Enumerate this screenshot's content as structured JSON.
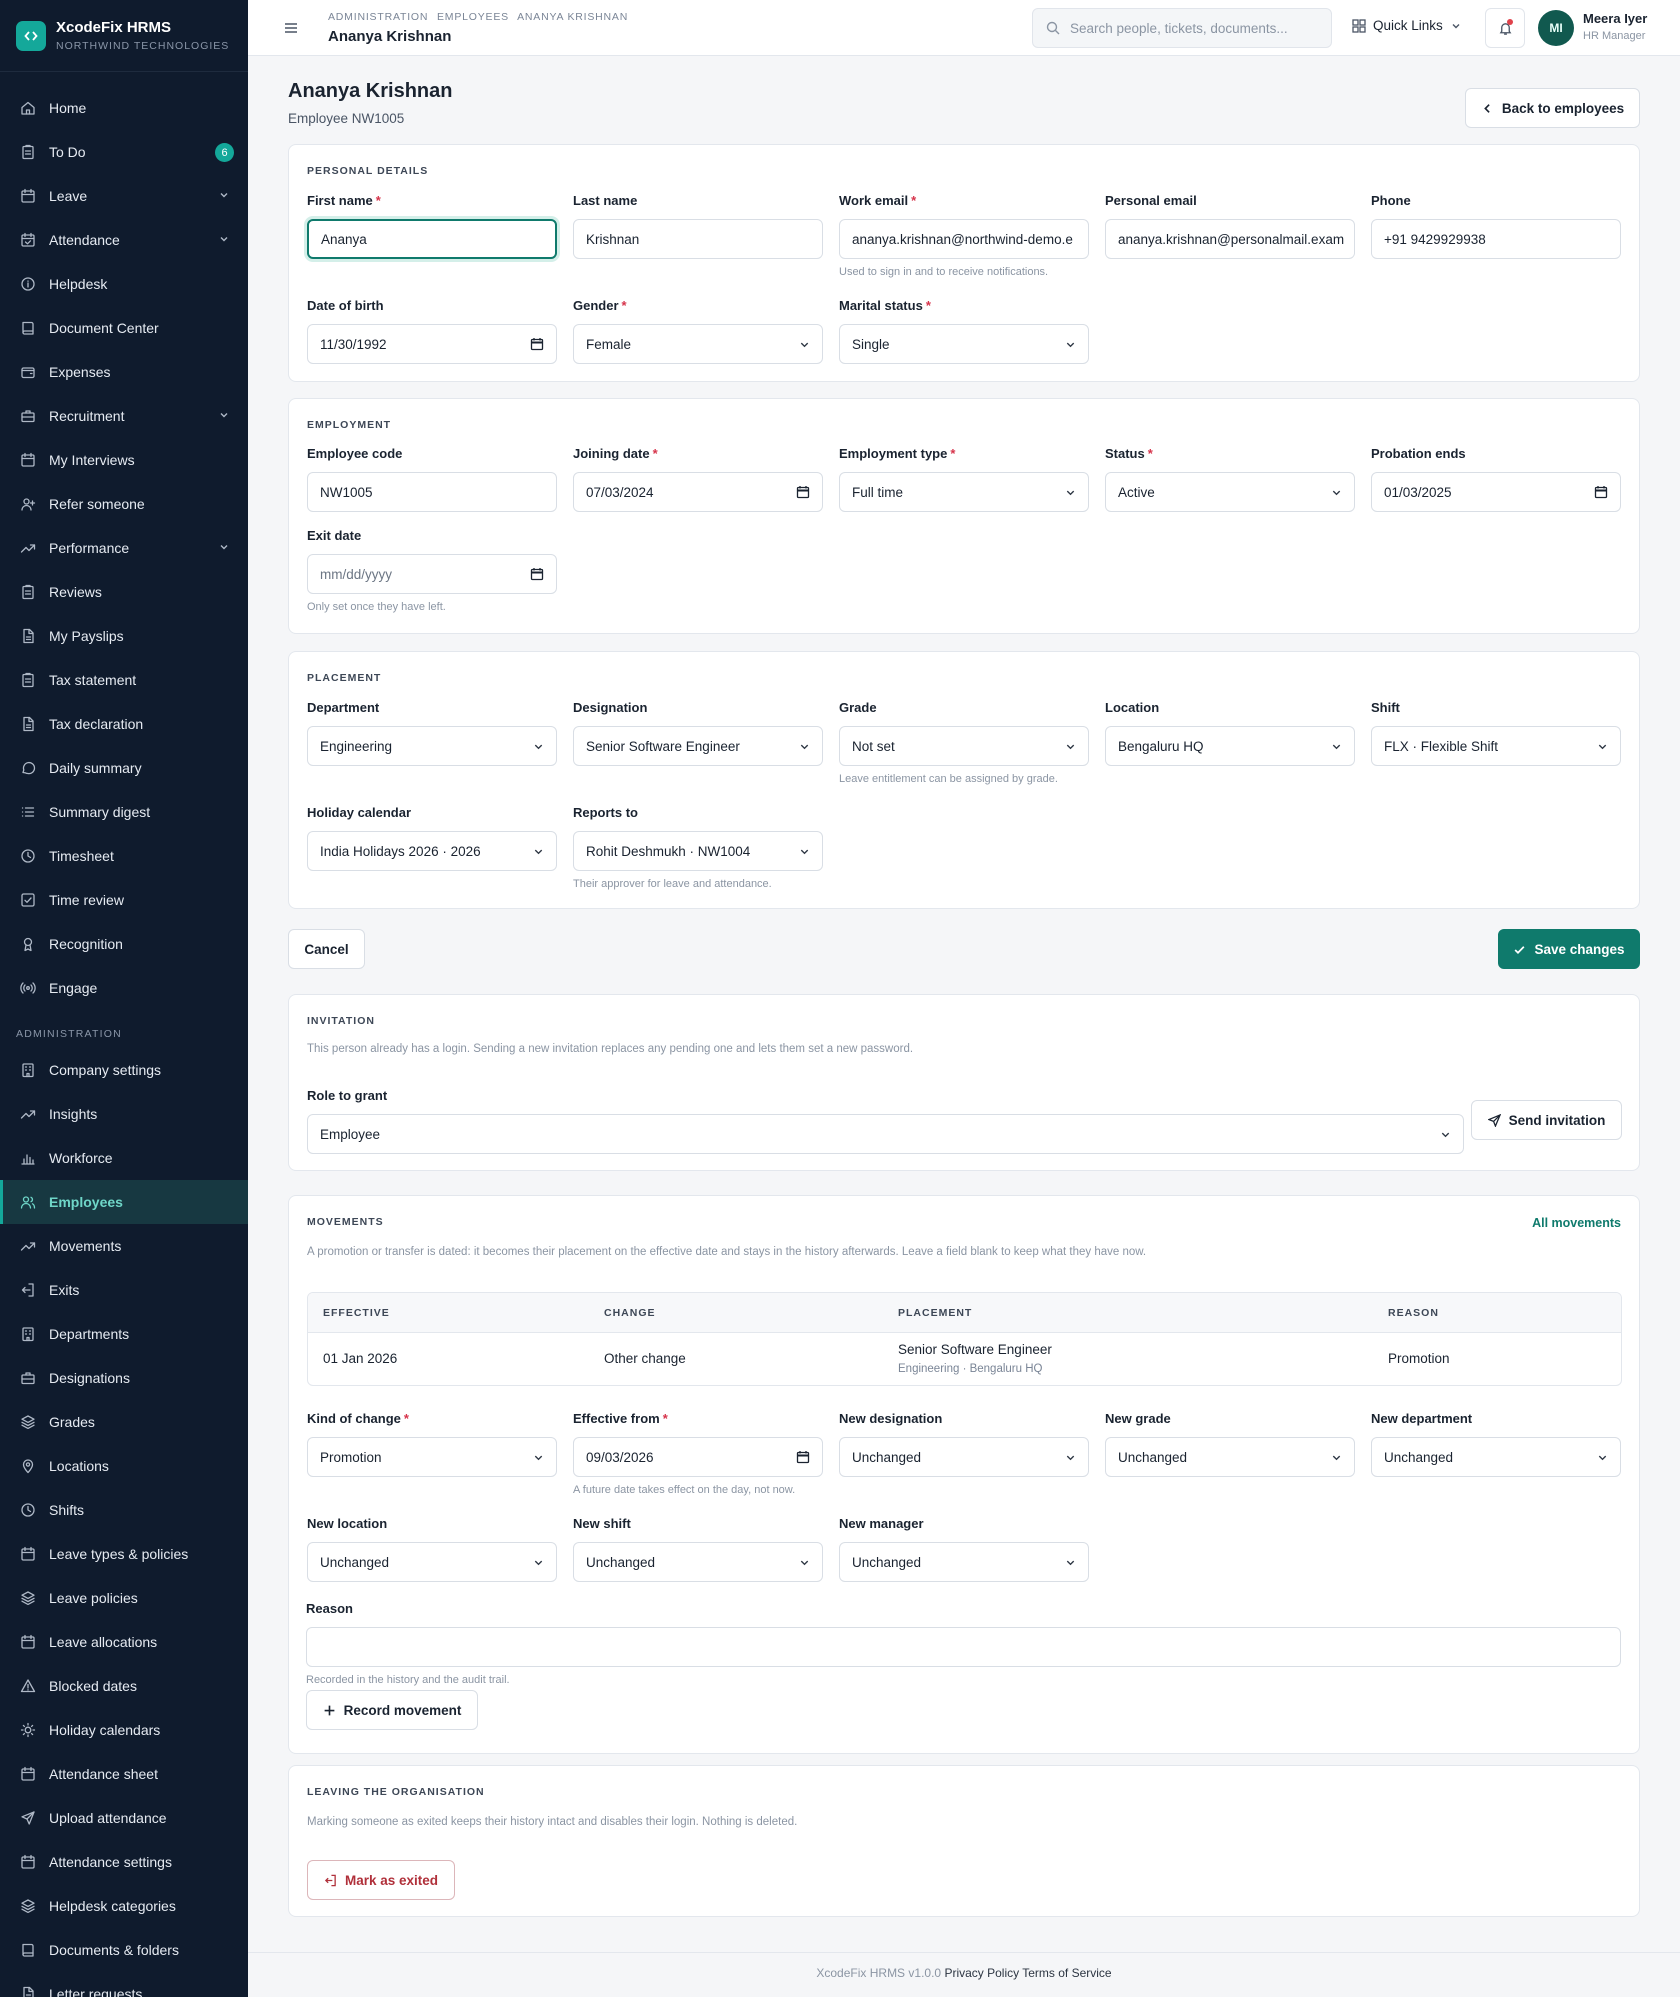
{
  "brand": {
    "name": "XcodeFix HRMS",
    "org": "NORTHWIND TECHNOLOGIES"
  },
  "nav": [
    {
      "label": "Home",
      "icon": "home-icon"
    },
    {
      "label": "To Do",
      "icon": "clipboard-icon",
      "badge": "6"
    },
    {
      "label": "Leave",
      "icon": "calendar-icon",
      "chevron": true
    },
    {
      "label": "Attendance",
      "icon": "calendar-check-icon",
      "chevron": true
    },
    {
      "label": "Helpdesk",
      "icon": "info-icon"
    },
    {
      "label": "Document Center",
      "icon": "book-icon"
    },
    {
      "label": "Expenses",
      "icon": "wallet-icon"
    },
    {
      "label": "Recruitment",
      "icon": "briefcase-icon",
      "chevron": true
    },
    {
      "label": "My Interviews",
      "icon": "calendar-icon"
    },
    {
      "label": "Refer someone",
      "icon": "user-plus-icon"
    },
    {
      "label": "Performance",
      "icon": "trending-up-icon",
      "chevron": true
    },
    {
      "label": "Reviews",
      "icon": "clipboard-icon"
    },
    {
      "label": "My Payslips",
      "icon": "file-icon"
    },
    {
      "label": "Tax statement",
      "icon": "clipboard-icon"
    },
    {
      "label": "Tax declaration",
      "icon": "file-icon"
    },
    {
      "label": "Daily summary",
      "icon": "message-icon"
    },
    {
      "label": "Summary digest",
      "icon": "list-icon"
    },
    {
      "label": "Timesheet",
      "icon": "clock-icon"
    },
    {
      "label": "Time review",
      "icon": "check-square-icon"
    },
    {
      "label": "Recognition",
      "icon": "award-icon"
    },
    {
      "label": "Engage",
      "icon": "broadcast-icon"
    }
  ],
  "admin_section": "ADMINISTRATION",
  "admin_nav": [
    {
      "label": "Company settings",
      "icon": "building-icon"
    },
    {
      "label": "Insights",
      "icon": "trending-up-icon"
    },
    {
      "label": "Workforce",
      "icon": "bar-chart-icon"
    },
    {
      "label": "Employees",
      "icon": "users-icon",
      "active": true
    },
    {
      "label": "Movements",
      "icon": "trending-up-icon"
    },
    {
      "label": "Exits",
      "icon": "log-out-icon"
    },
    {
      "label": "Departments",
      "icon": "building-icon"
    },
    {
      "label": "Designations",
      "icon": "briefcase-icon"
    },
    {
      "label": "Grades",
      "icon": "layers-icon"
    },
    {
      "label": "Locations",
      "icon": "map-pin-icon"
    },
    {
      "label": "Shifts",
      "icon": "clock-icon"
    },
    {
      "label": "Leave types & policies",
      "icon": "calendar-icon"
    },
    {
      "label": "Leave policies",
      "icon": "layers-icon"
    },
    {
      "label": "Leave allocations",
      "icon": "calendar-icon"
    },
    {
      "label": "Blocked dates",
      "icon": "alert-triangle-icon"
    },
    {
      "label": "Holiday calendars",
      "icon": "sun-icon"
    },
    {
      "label": "Attendance sheet",
      "icon": "calendar-icon"
    },
    {
      "label": "Upload attendance",
      "icon": "send-icon"
    },
    {
      "label": "Attendance settings",
      "icon": "calendar-icon"
    },
    {
      "label": "Helpdesk categories",
      "icon": "layers-icon"
    },
    {
      "label": "Documents & folders",
      "icon": "book-icon"
    },
    {
      "label": "Letter requests",
      "icon": "file-icon"
    }
  ],
  "topbar": {
    "breadcrumb": [
      "ADMINISTRATION",
      "EMPLOYEES",
      "ANANYA KRISHNAN"
    ],
    "title": "Ananya Krishnan",
    "search_placeholder": "Search people, tickets, documents...",
    "quick_links": "Quick Links",
    "user": {
      "initials": "MI",
      "name": "Meera Iyer",
      "role": "HR Manager"
    }
  },
  "page": {
    "title": "Ananya Krishnan",
    "subtitle": "Employee NW1005",
    "back": "Back to employees"
  },
  "personal": {
    "title": "PERSONAL DETAILS",
    "first_name": {
      "label": "First name",
      "value": "Ananya"
    },
    "last_name": {
      "label": "Last name",
      "value": "Krishnan"
    },
    "work_email": {
      "label": "Work email",
      "value": "ananya.krishnan@northwind-demo.e",
      "help": "Used to sign in and to receive notifications."
    },
    "personal_email": {
      "label": "Personal email",
      "value": "ananya.krishnan@personalmail.exam"
    },
    "phone": {
      "label": "Phone",
      "value": "+91 9429929938"
    },
    "dob": {
      "label": "Date of birth",
      "value": "11/30/1992"
    },
    "gender": {
      "label": "Gender",
      "value": "Female"
    },
    "marital": {
      "label": "Marital status",
      "value": "Single"
    }
  },
  "employment": {
    "title": "EMPLOYMENT",
    "code": {
      "label": "Employee code",
      "value": "NW1005"
    },
    "joining": {
      "label": "Joining date",
      "value": "07/03/2024"
    },
    "type": {
      "label": "Employment type",
      "value": "Full time"
    },
    "status": {
      "label": "Status",
      "value": "Active"
    },
    "probation": {
      "label": "Probation ends",
      "value": "01/03/2025"
    },
    "exit": {
      "label": "Exit date",
      "value": "mm/dd/yyyy",
      "help": "Only set once they have left."
    }
  },
  "placement": {
    "title": "PLACEMENT",
    "department": {
      "label": "Department",
      "value": "Engineering"
    },
    "designation": {
      "label": "Designation",
      "value": "Senior Software Engineer"
    },
    "grade": {
      "label": "Grade",
      "value": "Not set",
      "help": "Leave entitlement can be assigned by grade."
    },
    "location": {
      "label": "Location",
      "value": "Bengaluru HQ"
    },
    "shift": {
      "label": "Shift",
      "value": "FLX · Flexible Shift"
    },
    "holiday": {
      "label": "Holiday calendar",
      "value": "India Holidays 2026 · 2026"
    },
    "reports": {
      "label": "Reports to",
      "value": "Rohit Deshmukh · NW1004",
      "help": "Their approver for leave and attendance."
    }
  },
  "actions": {
    "cancel": "Cancel",
    "save": "Save changes"
  },
  "invitation": {
    "title": "INVITATION",
    "note": "This person already has a login. Sending a new invitation replaces any pending one and lets them set a new password.",
    "role_label": "Role to grant",
    "role_value": "Employee",
    "send": "Send invitation"
  },
  "movements": {
    "title": "MOVEMENTS",
    "all": "All movements",
    "note": "A promotion or transfer is dated: it becomes their placement on the effective date and stays in the history afterwards. Leave a field blank to keep what they have now.",
    "columns": [
      "EFFECTIVE",
      "CHANGE",
      "PLACEMENT",
      "REASON"
    ],
    "row": {
      "effective": "01 Jan 2026",
      "change": "Other change",
      "placement": "Senior Software Engineer",
      "placement_sub": "Engineering · Bengaluru HQ",
      "reason": "Promotion"
    },
    "kind": {
      "label": "Kind of change",
      "value": "Promotion"
    },
    "effective_from": {
      "label": "Effective from",
      "value": "09/03/2026",
      "help": "A future date takes effect on the day, not now."
    },
    "new_designation": {
      "label": "New designation",
      "value": "Unchanged"
    },
    "new_grade": {
      "label": "New grade",
      "value": "Unchanged"
    },
    "new_department": {
      "label": "New department",
      "value": "Unchanged"
    },
    "new_location": {
      "label": "New location",
      "value": "Unchanged"
    },
    "new_shift": {
      "label": "New shift",
      "value": "Unchanged"
    },
    "new_manager": {
      "label": "New manager",
      "value": "Unchanged"
    },
    "reason": {
      "label": "Reason",
      "value": "",
      "help": "Recorded in the history and the audit trail."
    },
    "record": "Record movement"
  },
  "leaving": {
    "title": "LEAVING THE ORGANISATION",
    "note": "Marking someone as exited keeps their history intact and disables their login. Nothing is deleted.",
    "button": "Mark as exited"
  },
  "footer": {
    "version": "XcodeFix HRMS v1.0.0",
    "privacy": "Privacy Policy",
    "terms": "Terms of Service"
  }
}
